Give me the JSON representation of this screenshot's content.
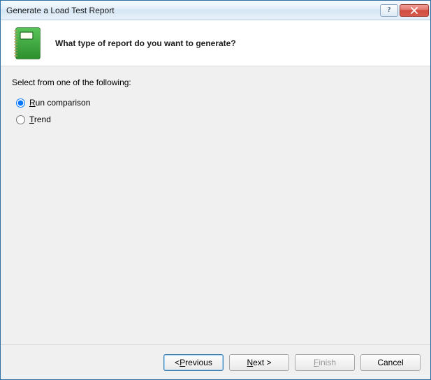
{
  "titlebar": {
    "title": "Generate a Load Test Report"
  },
  "header": {
    "question": "What type of report do you want to generate?"
  },
  "content": {
    "prompt": "Select from one of the following:",
    "options": [
      {
        "prefix": "R",
        "rest": "un comparison",
        "value": "run_comparison",
        "checked": true
      },
      {
        "prefix": "T",
        "rest": "rend",
        "value": "trend",
        "checked": false
      }
    ]
  },
  "buttons": {
    "previous": {
      "prefix": "< ",
      "key": "P",
      "rest": "revious"
    },
    "next": {
      "prefix": "",
      "key": "N",
      "rest": "ext >"
    },
    "finish": {
      "prefix": "",
      "key": "F",
      "rest": "inish"
    },
    "cancel": {
      "label": "Cancel"
    }
  }
}
